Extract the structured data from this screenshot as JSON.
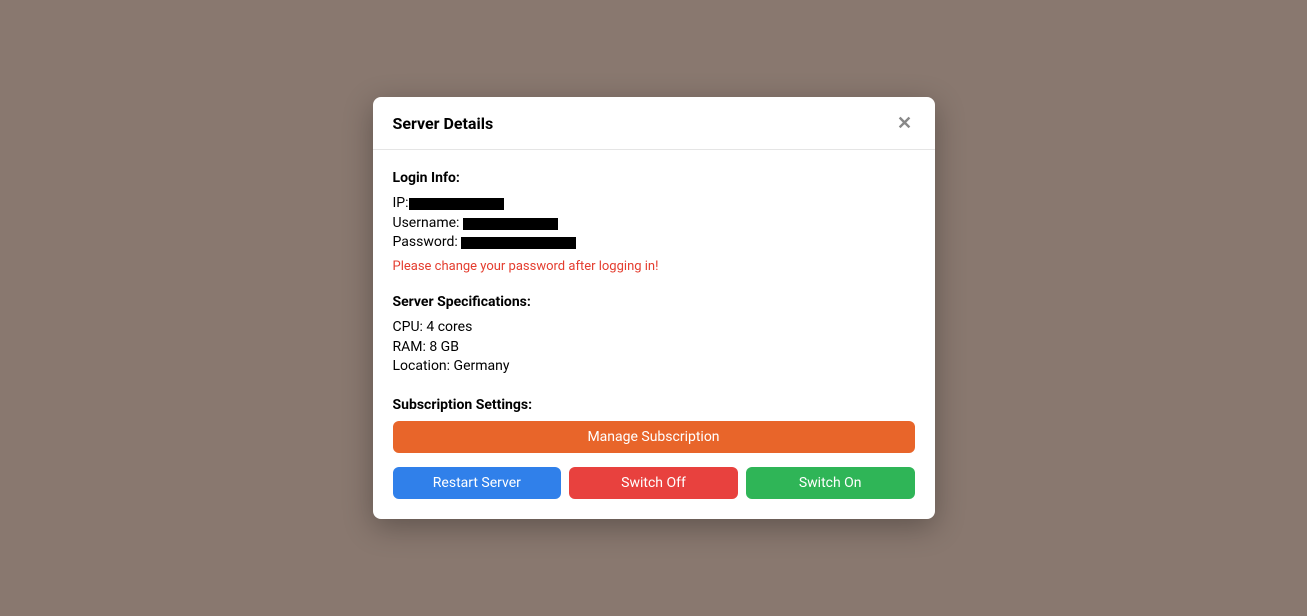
{
  "modal": {
    "title": "Server Details"
  },
  "login": {
    "heading": "Login Info:",
    "ip_label": "IP:",
    "username_label": "Username:",
    "password_label": "Password:",
    "warning": "Please change your password after logging in!"
  },
  "specs": {
    "heading": "Server Specifications:",
    "cpu": "CPU: 4 cores",
    "ram": "RAM: 8 GB",
    "location": "Location: Germany"
  },
  "subscription": {
    "heading": "Subscription Settings:",
    "manage_label": "Manage Subscription"
  },
  "actions": {
    "restart_label": "Restart Server",
    "switch_off_label": "Switch Off",
    "switch_on_label": "Switch On"
  }
}
